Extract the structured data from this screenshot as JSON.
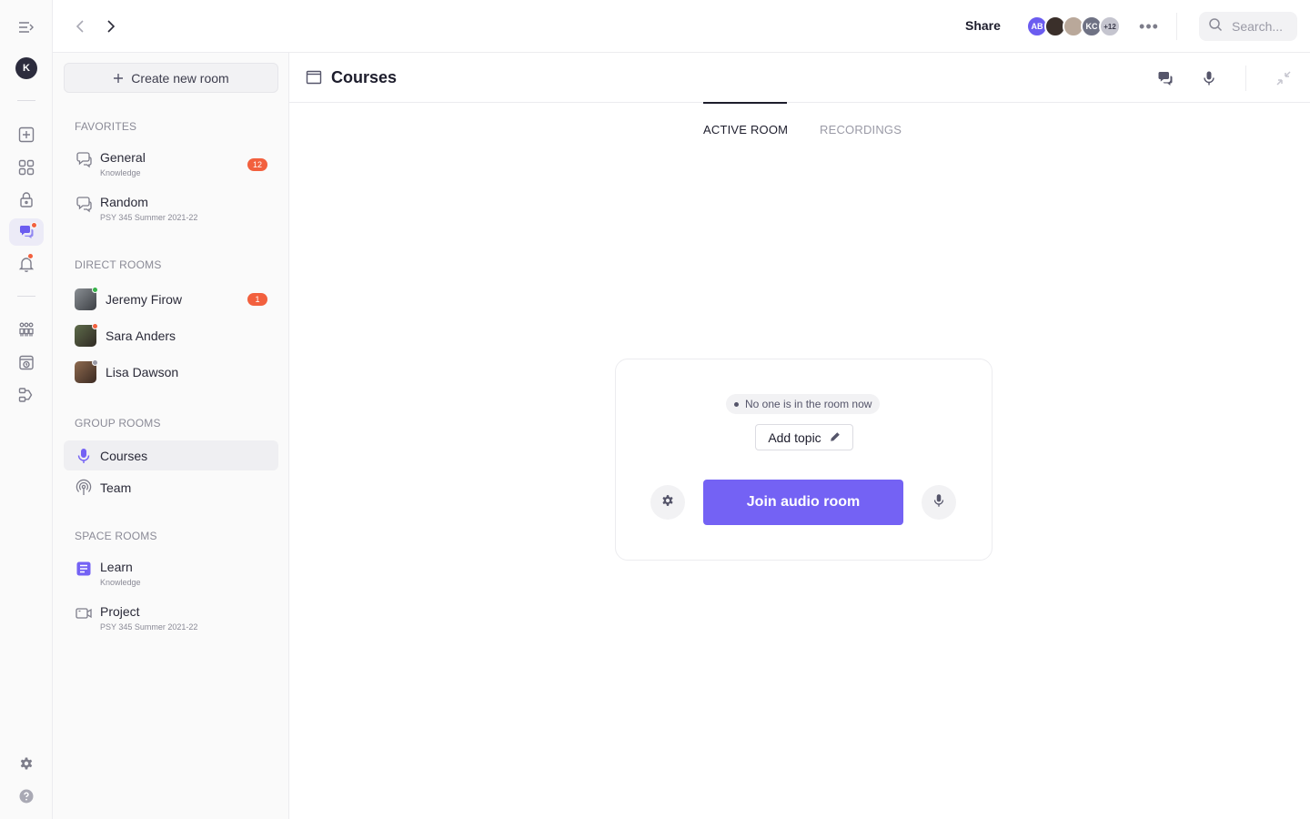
{
  "topbar": {
    "share_label": "Share",
    "avatars": [
      {
        "initials": "AB",
        "color": "#6b5cf0"
      },
      {
        "initials": "",
        "color": "#3a2f2a"
      },
      {
        "initials": "",
        "color": "#b9a89a"
      },
      {
        "initials": "KC",
        "color": "#6f7284"
      },
      {
        "initials": "+12",
        "color": "#c5c5cf"
      }
    ],
    "more_label": "•••",
    "search_placeholder": "Search..."
  },
  "rail": {
    "user_initial": "K",
    "icons": [
      "collapse-menu-icon",
      "add-square-icon",
      "grid-icon",
      "lock-icon",
      "chat-bubbles-icon",
      "bell-icon",
      "people-group-icon",
      "calendar-clock-icon",
      "workflow-icon",
      "settings-icon",
      "help-icon"
    ]
  },
  "sidebar": {
    "create_label": "Create new room",
    "favorites_title": "FAVORITES",
    "favorites": [
      {
        "name": "General",
        "sub": "Knowledge",
        "badge": "12"
      },
      {
        "name": "Random",
        "sub": "PSY 345 Summer 2021-22"
      }
    ],
    "direct_title": "DIRECT ROOMS",
    "direct": [
      {
        "name": "Jeremy Firow",
        "badge": "1",
        "status_color": "#38b24a"
      },
      {
        "name": "Sara Anders",
        "status_color": "#f2603e"
      },
      {
        "name": "Lisa Dawson",
        "status_color": "#9a9aa6"
      }
    ],
    "group_title": "GROUP ROOMS",
    "group": [
      {
        "name": "Courses"
      },
      {
        "name": "Team"
      }
    ],
    "space_title": "SPACE ROOMS",
    "space": [
      {
        "name": "Learn",
        "sub": "Knowledge"
      },
      {
        "name": "Project",
        "sub": "PSY 345 Summer 2021-22"
      }
    ]
  },
  "main": {
    "title": "Courses",
    "tabs": [
      {
        "label": "ACTIVE ROOM",
        "active": true
      },
      {
        "label": "RECORDINGS",
        "active": false
      }
    ],
    "card": {
      "status": "No one is in the room now",
      "add_topic_label": "Add topic",
      "join_label": "Join audio room"
    }
  },
  "colors": {
    "accent": "#7462f4",
    "badge": "#f2603e",
    "text": "#1d1d2c"
  }
}
